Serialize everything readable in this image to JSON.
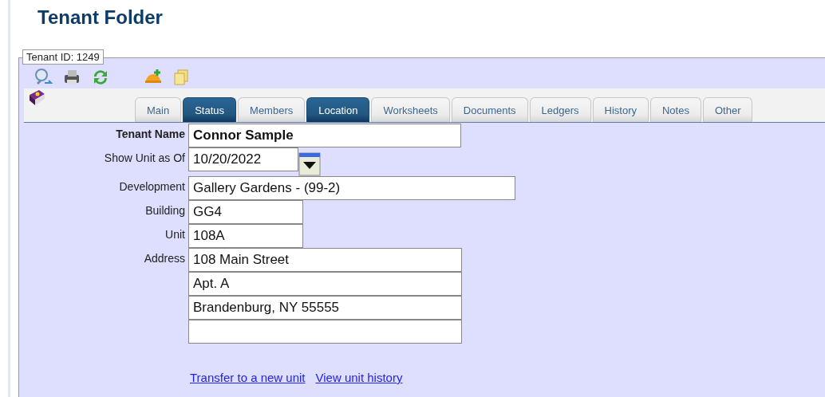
{
  "page_title": "Tenant Folder",
  "tenant_id": "Tenant ID: 1249",
  "tabs": [
    {
      "label": "Main",
      "selected": false
    },
    {
      "label": "Status",
      "selected": true
    },
    {
      "label": "Members",
      "selected": false
    },
    {
      "label": "Location",
      "selected": true
    },
    {
      "label": "Worksheets",
      "selected": false
    },
    {
      "label": "Documents",
      "selected": false
    },
    {
      "label": "Ledgers",
      "selected": false
    },
    {
      "label": "History",
      "selected": false
    },
    {
      "label": "Notes",
      "selected": false
    },
    {
      "label": "Other",
      "selected": false
    }
  ],
  "form": [
    {
      "label": "Tenant Name",
      "kind": "name",
      "values": [
        "Connor Sample"
      ]
    },
    {
      "label": "Show Unit as Of",
      "kind": "date",
      "values": [
        "10/20/2022"
      ]
    },
    {
      "label": "Development",
      "kind": "wide",
      "values": [
        "Gallery Gardens - (99-2)"
      ]
    },
    {
      "label": "Building",
      "kind": "short",
      "values": [
        "GG4"
      ]
    },
    {
      "label": "Unit",
      "kind": "short",
      "values": [
        "108A"
      ]
    },
    {
      "label": "Address",
      "kind": "address",
      "values": [
        "108 Main Street",
        "Apt. A",
        "Brandenburg, NY 55555"
      ],
      "blank_line": {
        "kind": "blank"
      }
    }
  ],
  "links": [
    "Transfer to a new unit",
    "View unit history"
  ]
}
